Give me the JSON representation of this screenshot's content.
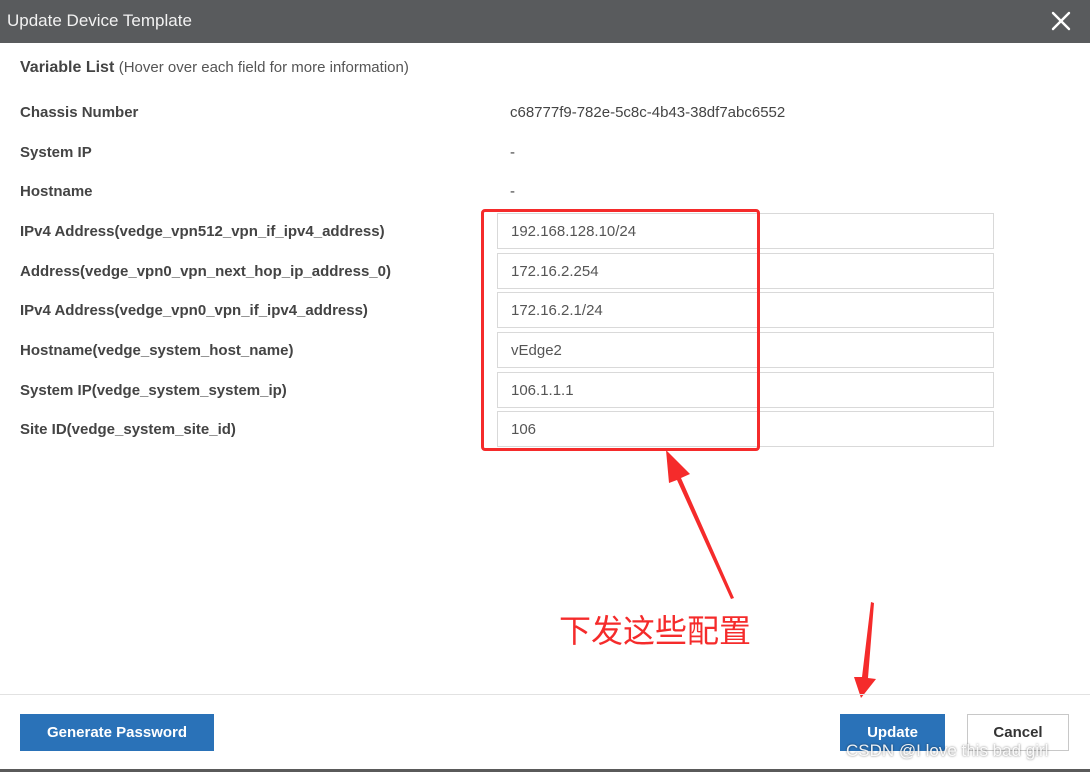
{
  "dialog": {
    "title": "Update Device Template",
    "close_icon": "close-icon"
  },
  "variable_list": {
    "heading": "Variable List",
    "subheading": "(Hover over each field for more information)"
  },
  "static_rows": [
    {
      "label": "Chassis Number",
      "value": "c68777f9-782e-5c8c-4b43-38df7abc6552"
    },
    {
      "label": "System IP",
      "value": "-"
    },
    {
      "label": "Hostname",
      "value": "-"
    }
  ],
  "input_rows": [
    {
      "label": "IPv4 Address(vedge_vpn512_vpn_if_ipv4_address)",
      "value": "192.168.128.10/24"
    },
    {
      "label": "Address(vedge_vpn0_vpn_next_hop_ip_address_0)",
      "value": "172.16.2.254"
    },
    {
      "label": "IPv4 Address(vedge_vpn0_vpn_if_ipv4_address)",
      "value": "172.16.2.1/24"
    },
    {
      "label": "Hostname(vedge_system_host_name)",
      "value": "vEdge2"
    },
    {
      "label": "System IP(vedge_system_system_ip)",
      "value": "106.1.1.1"
    },
    {
      "label": "Site ID(vedge_system_site_id)",
      "value": "106"
    }
  ],
  "footer": {
    "generate_password_label": "Generate Password",
    "update_label": "Update",
    "cancel_label": "Cancel"
  },
  "annotation": {
    "text": "下发这些配置",
    "color": "#f52b2b"
  },
  "watermark": "CSDN @I love this bad girl",
  "colors": {
    "titlebar": "#595b5d",
    "primary_button": "#2a72b8"
  }
}
